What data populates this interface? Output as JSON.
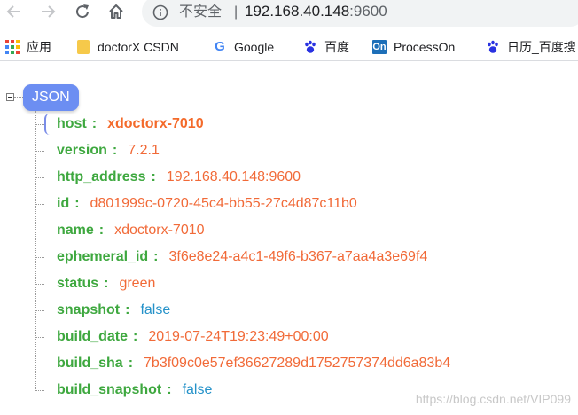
{
  "browser": {
    "security_label": "不安全",
    "separator": "|",
    "url_host": "192.168.40.148",
    "url_port": ":9600"
  },
  "bookmarks": [
    {
      "label": "应用",
      "icon": "apps-grid-icon"
    },
    {
      "label": "doctorX CSDN",
      "icon": "folder-icon"
    },
    {
      "label": "Google",
      "icon": "google-icon"
    },
    {
      "label": "百度",
      "icon": "baidu-paw-icon"
    },
    {
      "label": "ProcessOn",
      "icon": "processon-icon"
    },
    {
      "label": "日历_百度搜",
      "icon": "baidu-paw-icon"
    }
  ],
  "processon_icon_text": "On",
  "google_icon_text": "G",
  "tree": {
    "root_label": "JSON",
    "colon": ":",
    "rows": [
      {
        "key": "host",
        "value": "xdoctorx-7010",
        "type": "string",
        "selected": true
      },
      {
        "key": "version",
        "value": "7.2.1",
        "type": "string"
      },
      {
        "key": "http_address",
        "value": "192.168.40.148:9600",
        "type": "string"
      },
      {
        "key": "id",
        "value": "d801999c-0720-45c4-bb55-27c4d87c11b0",
        "type": "string"
      },
      {
        "key": "name",
        "value": "xdoctorx-7010",
        "type": "string"
      },
      {
        "key": "ephemeral_id",
        "value": "3f6e8e24-a4c1-49f6-b367-a7aa4a3e69f4",
        "type": "string"
      },
      {
        "key": "status",
        "value": "green",
        "type": "string"
      },
      {
        "key": "snapshot",
        "value": "false",
        "type": "boolean"
      },
      {
        "key": "build_date",
        "value": "2019-07-24T19:23:49+00:00",
        "type": "string"
      },
      {
        "key": "build_sha",
        "value": "7b3f09c0e57ef36627289d1752757374dd6a83b4",
        "type": "string"
      },
      {
        "key": "build_snapshot",
        "value": "false",
        "type": "boolean"
      }
    ]
  },
  "watermark": "https://blog.csdn.net/VIP099",
  "colors": {
    "key": "#3ea83f",
    "string_value": "#f16a38",
    "boolean_value": "#2592c9",
    "root_badge": "#6c8ef2"
  }
}
